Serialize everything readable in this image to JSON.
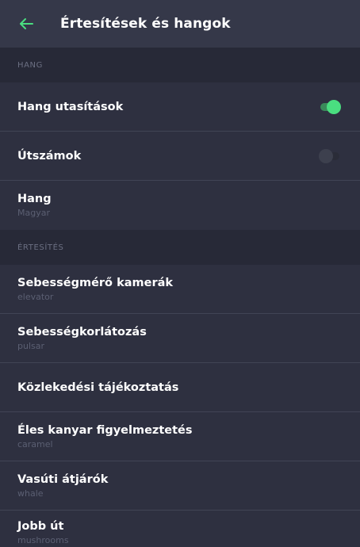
{
  "header": {
    "title": "Értesítések és hangok",
    "back_icon": "arrow-left-icon",
    "accent_color": "#4ade80"
  },
  "sections": {
    "hang": {
      "label": "HANG",
      "rows": {
        "voice_instructions": {
          "title": "Hang utasítások",
          "toggle": true
        },
        "road_numbers": {
          "title": "Útszámok",
          "toggle": false
        },
        "voice": {
          "title": "Hang",
          "subtitle": "Magyar"
        }
      }
    },
    "ertesites": {
      "label": "ÉRTESÍTÉS",
      "rows": {
        "speed_cameras": {
          "title": "Sebességmérő kamerák",
          "subtitle": "elevator"
        },
        "speed_limits": {
          "title": "Sebességkorlátozás",
          "subtitle": "pulsar"
        },
        "traffic_info": {
          "title": "Közlekedési tájékoztatás"
        },
        "sharp_turn": {
          "title": "Éles kanyar figyelmeztetés",
          "subtitle": "caramel"
        },
        "railway_crossings": {
          "title": "Vasúti átjárók",
          "subtitle": "whale"
        },
        "right_way": {
          "title": "Jobb út",
          "subtitle": "mushrooms"
        }
      }
    }
  }
}
